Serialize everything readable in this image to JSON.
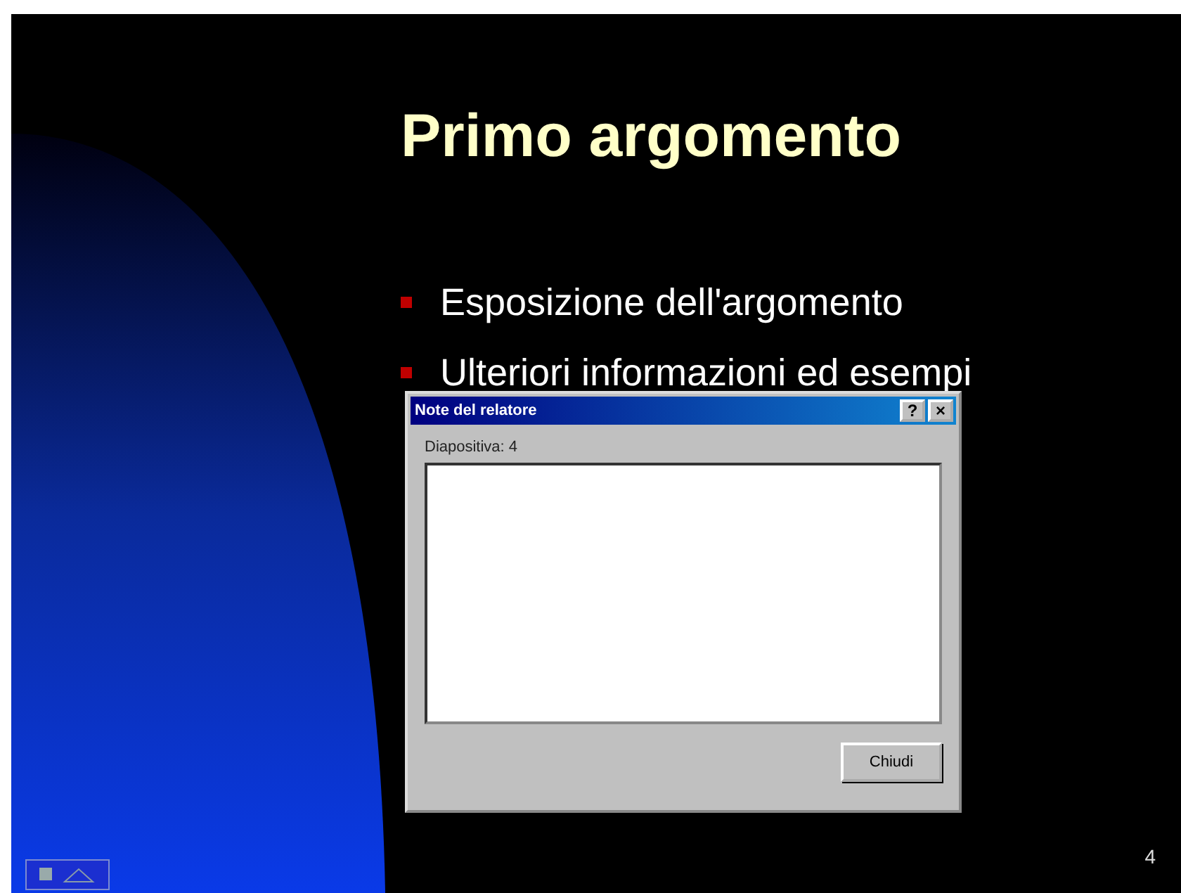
{
  "slide": {
    "title": "Primo argomento",
    "bullets": [
      {
        "text": "Esposizione dell'argomento"
      },
      {
        "text": "Ulteriori informazioni ed esempi"
      }
    ],
    "slide_number": "4"
  },
  "dialog": {
    "title": "Note del relatore",
    "help_button": "?",
    "close_button": "×",
    "label": "Diapositiva: 4",
    "button": "Chiudi"
  }
}
